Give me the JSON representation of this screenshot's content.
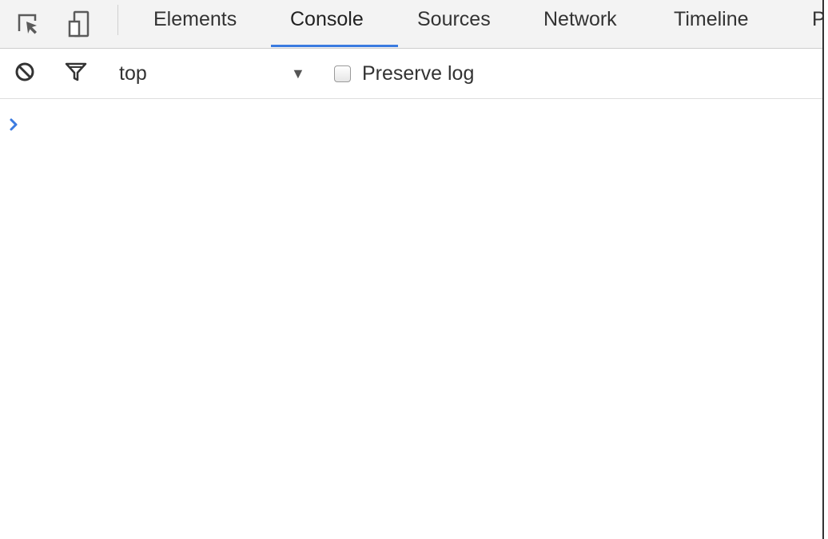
{
  "tabbar": {
    "tools": [
      {
        "icon": "inspect-element-icon"
      },
      {
        "icon": "device-mode-icon"
      }
    ],
    "tabs": [
      {
        "label": "Elements",
        "selected": false
      },
      {
        "label": "Console",
        "selected": true
      },
      {
        "label": "Sources",
        "selected": false
      },
      {
        "label": "Network",
        "selected": false
      },
      {
        "label": "Timeline",
        "selected": false
      },
      {
        "label": "Pr",
        "selected": false
      }
    ]
  },
  "toolbar": {
    "clear_icon": "clear-console-icon",
    "filter_icon": "filter-icon",
    "context_value": "top",
    "context_arrow": "▼",
    "preserve_log_label": "Preserve log",
    "preserve_log_checked": false
  },
  "console": {
    "prompt_icon": "prompt-chevron-icon",
    "input_value": ""
  },
  "colors": {
    "accent": "#3b7be0",
    "tabbar_bg": "#f3f3f3",
    "text": "#333333",
    "border": "#cccccc"
  }
}
